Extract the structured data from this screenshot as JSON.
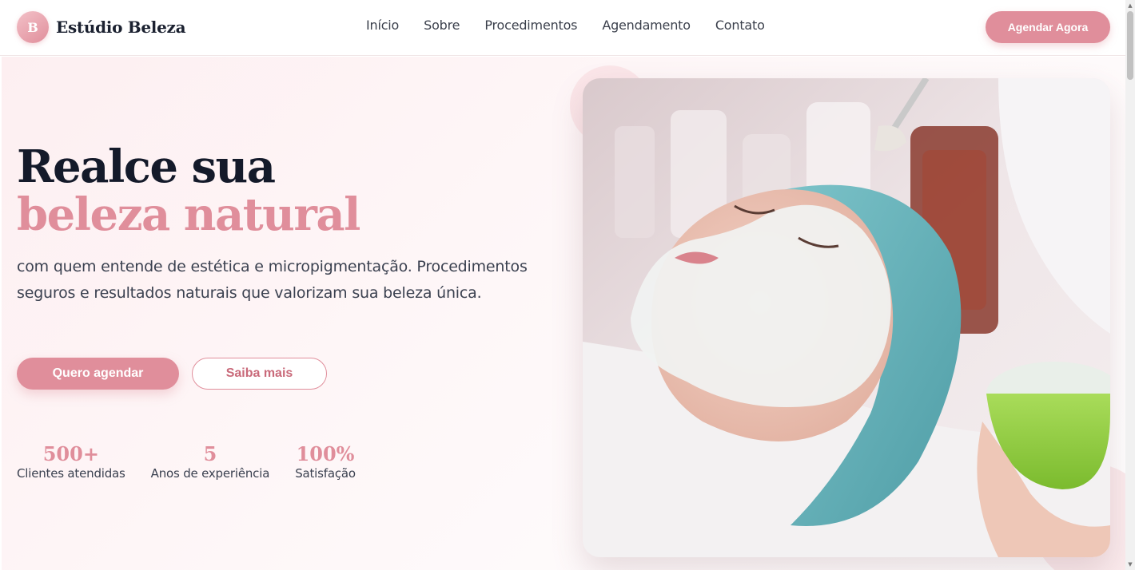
{
  "brand": {
    "initial": "B",
    "name": "Estúdio Beleza"
  },
  "nav": {
    "items": [
      "Início",
      "Sobre",
      "Procedimentos",
      "Agendamento",
      "Contato"
    ]
  },
  "header": {
    "cta_label": "Agendar Agora"
  },
  "hero": {
    "headline_line1": "Realce sua",
    "headline_line2": "beleza natural",
    "subtitle": "com quem entende de estética e micropigmentação. Procedimentos seguros e resultados naturais que valorizam sua beleza única.",
    "primary_button": "Quero agendar",
    "secondary_button": "Saiba mais",
    "stats": [
      {
        "value": "500+",
        "label": "Clientes atendidas"
      },
      {
        "value": "5",
        "label": "Anos de experiência"
      },
      {
        "value": "100%",
        "label": "Satisfação"
      }
    ],
    "image_icon": "facial-treatment-photo"
  },
  "colors": {
    "accent": "#e08e9b",
    "accent_dark": "#c96a7a",
    "heading": "#141a2a",
    "text": "#3b4150",
    "hero_bg": "#fdeff1"
  }
}
